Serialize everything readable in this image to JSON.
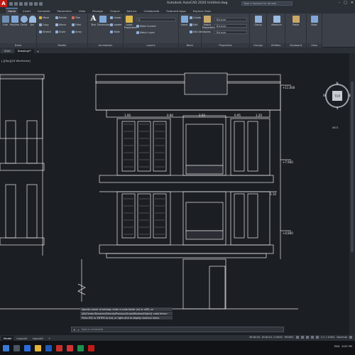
{
  "titlebar": {
    "title": "Autodesk AutoCAD 2020   Untitled.dwg",
    "search_placeholder": "Type a keyword or phrase",
    "logo_letter": "A"
  },
  "tabs": [
    "Home",
    "Insert",
    "Annotate",
    "Parametric",
    "View",
    "Manage",
    "Output",
    "Add-ins",
    "Collaborate",
    "Featured Apps",
    "Express Tools"
  ],
  "ribbon": {
    "draw": {
      "title": "Draw",
      "line": "Line",
      "polyline": "Polyline",
      "circle": "Circle",
      "arc": "Arc"
    },
    "modify": {
      "title": "Modify",
      "tools": [
        "Move",
        "Rotate",
        "Trim",
        "Copy",
        "Mirror",
        "Fillet",
        "Stretch",
        "Scale",
        "Array"
      ]
    },
    "annotation": {
      "title": "Annotation",
      "text": "Text",
      "dimension": "Dimension",
      "linear": "Linear",
      "leader": "Leader",
      "table": "Table"
    },
    "layers": {
      "title": "Layers",
      "properties": "Layer Properties",
      "current_layer": "0",
      "make_current": "Make Current",
      "match_layer": "Match Layer"
    },
    "block": {
      "title": "Block",
      "insert": "Insert",
      "create": "Create",
      "edit": "Edit",
      "edit_attributes": "Edit Attributes"
    },
    "properties": {
      "title": "Properties",
      "match": "Match Properties",
      "color": "ByLayer",
      "linetype": "ByLayer",
      "lineweight": "ByLayer"
    },
    "groups": {
      "title": "Groups",
      "group": "Group"
    },
    "utilities": {
      "title": "Utilities",
      "measure": "Measure"
    },
    "clipboard": {
      "title": "Clipboard",
      "paste": "Paste"
    },
    "view": {
      "title": "View",
      "base": "Base"
    }
  },
  "file_tabs": [
    "Start",
    "Drawing1*"
  ],
  "viewport_label": "[-][Top][2D Wireframe]",
  "viewcube": {
    "top": "TOP",
    "n": "N",
    "s": "S",
    "e": "E",
    "w": "W",
    "wcs": "WCS"
  },
  "drawing": {
    "level_labels": [
      "+11.000",
      "+7.900",
      "+4.800"
    ],
    "dim_labels": [
      "1.00",
      "0.80",
      "2.50",
      "0.95",
      "1.20",
      "3.10"
    ]
  },
  "command": {
    "history": [
      "Specify corner of window, enter a scale factor (nX or nXP), or",
      "[All/Center/Dynamic/Extents/Previous/Scale/Window/Object] <real time>:",
      "Press ESC or ENTER to exit, or right-click to display shortcut menu."
    ],
    "prompt": "Type a command"
  },
  "layout_tabs": [
    "Model",
    "Layout1",
    "Layout2"
  ],
  "status": {
    "coords": "36.6218, 16.6210, 0.0000",
    "mode": "MODEL",
    "scale": "1:1 / 100%",
    "units": "Decimal"
  },
  "taskbar": {
    "lang": "ENG",
    "time": "8:05 PM"
  },
  "colors": {
    "accent": "#5aa0e6",
    "logo": "#c11b17",
    "drawing_line": "#e8e8e8",
    "bg": "#1b1e23"
  }
}
